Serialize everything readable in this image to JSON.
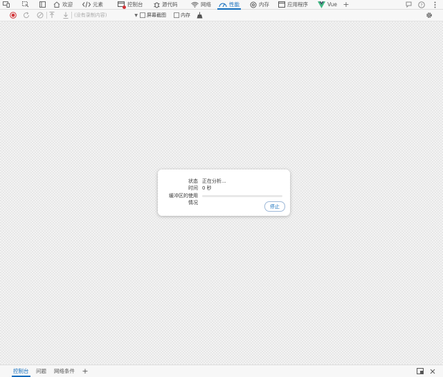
{
  "tabs": [
    {
      "label": "欢迎",
      "icon": "home-icon"
    },
    {
      "label": "元素",
      "icon": "code-icon"
    },
    {
      "label": "控制台",
      "icon": "console-icon"
    },
    {
      "label": "源代码",
      "icon": "bug-icon"
    },
    {
      "label": "网络",
      "icon": "wifi-icon"
    },
    {
      "label": "性能",
      "icon": "performance-gauge-icon",
      "active": true
    },
    {
      "label": "内存",
      "icon": "memory-icon"
    },
    {
      "label": "应用程序",
      "icon": "application-icon"
    },
    {
      "label": "Vue",
      "icon": "vue-logo-icon"
    }
  ],
  "toolbar": {
    "profile_select": "(没有录制内容)",
    "screenshots_label": "屏幕截图",
    "memory_label": "内存"
  },
  "dialog": {
    "status_label": "状态",
    "status_value": "正在分析...",
    "time_label": "时间",
    "time_value": "0 秒",
    "buffer_label_line1": "缓冲区的使用",
    "buffer_label_line2": "情况",
    "buffer_usage_fraction": 0.0,
    "stop_button": "停止"
  },
  "drawer": {
    "tabs": [
      "控制台",
      "问题",
      "网络条件"
    ],
    "active_tab": "控制台"
  },
  "colors": {
    "accent": "#0f6cbd",
    "record": "#d13438",
    "vue": "#41b883"
  }
}
